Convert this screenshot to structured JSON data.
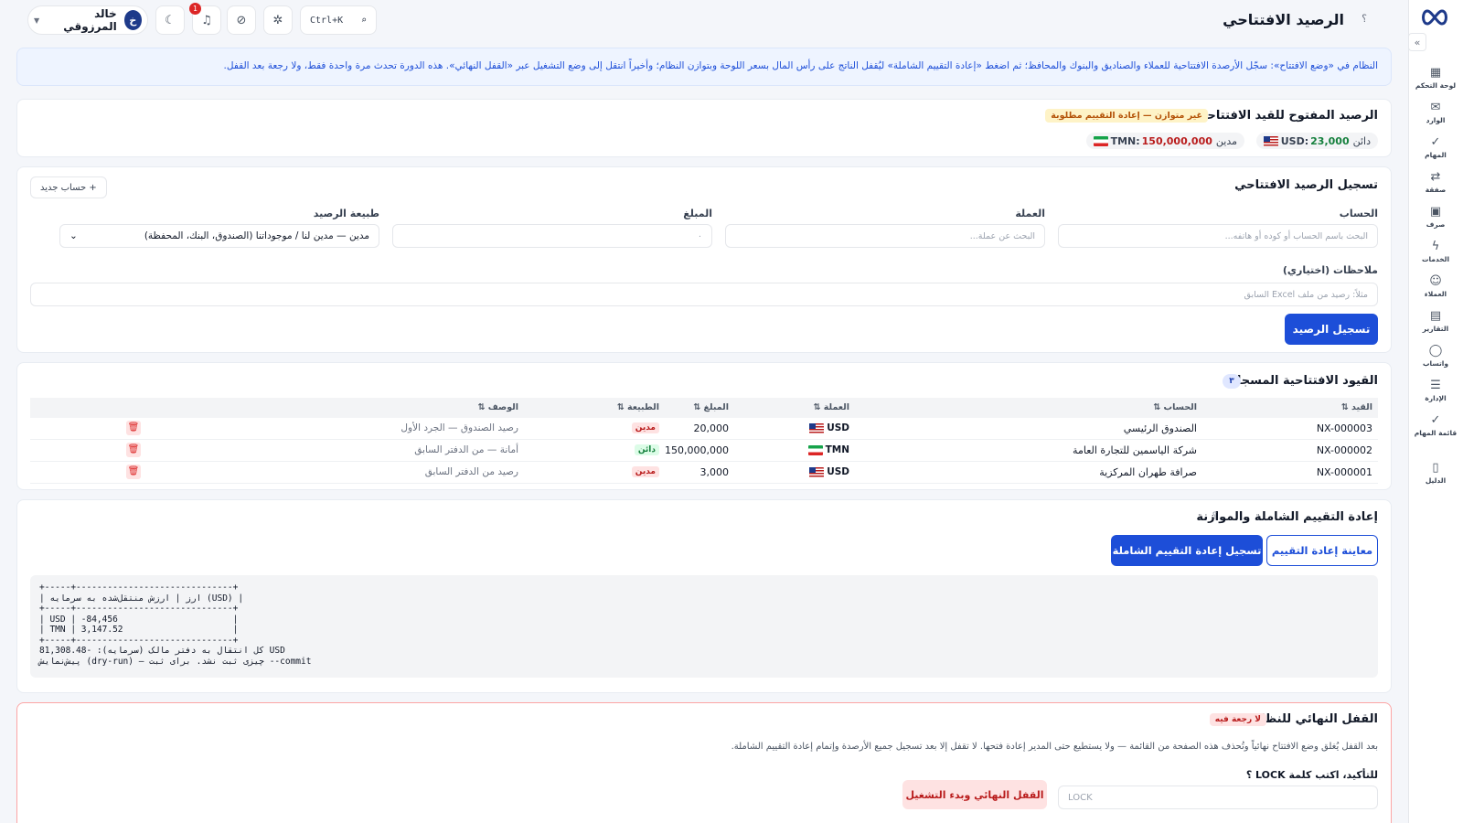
{
  "topbar": {
    "title": "الرصيد الافتتاحي",
    "help": "؟",
    "search_shortcut": "Ctrl+K",
    "notifications_count": "1",
    "user": {
      "initial": "خ",
      "name": "خالد المرزوقي"
    }
  },
  "sidebar": {
    "collapse": "»",
    "items": [
      {
        "label": "لوحة التحكم",
        "icon": "dashboard-icon",
        "glyph": "▦"
      },
      {
        "label": "الوارد",
        "icon": "inbox-icon",
        "glyph": "✉"
      },
      {
        "label": "المهام",
        "icon": "check-icon",
        "glyph": "✓"
      },
      {
        "label": "صفقة",
        "icon": "exchange-icon",
        "glyph": "⇄"
      },
      {
        "label": "صرف",
        "icon": "cash-icon",
        "glyph": "▣"
      },
      {
        "label": "الخدمات",
        "icon": "bolt-icon",
        "glyph": "ϟ"
      },
      {
        "label": "العملاء",
        "icon": "users-icon",
        "glyph": "☺"
      },
      {
        "label": "التقارير",
        "icon": "report-icon",
        "glyph": "▤"
      },
      {
        "label": "واتساب",
        "icon": "chat-icon",
        "glyph": "◯"
      },
      {
        "label": "الإدارة",
        "icon": "sliders-icon",
        "glyph": "☰"
      },
      {
        "label": "قائمة المهام",
        "icon": "tasks-icon",
        "glyph": "✓"
      },
      {
        "label": "الدليل",
        "icon": "book-icon",
        "glyph": "▯"
      }
    ]
  },
  "banner": {
    "text": "النظام في «وضع الافتتاح»: سجّل الأرصدة الافتتاحية للعملاء والصناديق والبنوك والمحافظ؛ ثم اضغط «إعادة التقييم الشاملة» ليُقفل الناتج على رأس المال بسعر اللوحة وبتوازن النظام؛ وأخيراً انتقل إلى وضع التشغيل عبر «القفل النهائي». هذه الدورة تحدث مرة واحدة فقط، ولا رجعة بعد القفل."
  },
  "open_balance": {
    "title": "الرصيد المفتوح للقيد الافتتاحي",
    "status": "غير متوازن — إعادة التقييم مطلوبة",
    "balances": [
      {
        "ccy": "USD",
        "amount": "23,000",
        "side": "دائن"
      },
      {
        "ccy": "TMN",
        "amount": "150,000,000",
        "side": "مدين"
      }
    ]
  },
  "form": {
    "title": "تسجيل الرصيد الافتتاحي",
    "new_account": "+ حساب جديد",
    "account_label": "الحساب",
    "account_placeholder": "البحث باسم الحساب أو كوده أو هاتفه...",
    "currency_label": "العملة",
    "currency_placeholder": "البحث عن عملة...",
    "amount_label": "المبلغ",
    "amount_placeholder": "٠",
    "nature_label": "طبيعة الرصيد",
    "nature_value": "مدين — مدين لنا / موجوداتنا (الصندوق، البنك، المحفظة)",
    "notes_label": "ملاحظات (اختياري)",
    "notes_placeholder": "مثلاً: رصيد من ملف Excel السابق",
    "submit": "تسجيل الرصيد"
  },
  "entries": {
    "title": "القيود الافتتاحية المسجلة",
    "count": "٣",
    "columns": [
      "القيد ⇅",
      "الحساب ⇅",
      "العملة ⇅",
      "المبلغ ⇅",
      "الطبيعة ⇅",
      "الوصف ⇅"
    ],
    "rows": [
      {
        "id": "NX-000003",
        "account": "الصندوق الرئيسي",
        "ccy": "USD",
        "flag": "us",
        "amount": "20,000",
        "nature": "مدين",
        "nature_type": "debit",
        "desc": "رصيد الصندوق — الجرد الأول"
      },
      {
        "id": "NX-000002",
        "account": "شركة الياسمين للتجارة العامة",
        "ccy": "TMN",
        "flag": "ir",
        "amount": "150,000,000",
        "nature": "دائن",
        "nature_type": "credit",
        "desc": "أمانة — من الدفتر السابق"
      },
      {
        "id": "NX-000001",
        "account": "صرافة طهران المركزية",
        "ccy": "USD",
        "flag": "us",
        "amount": "3,000",
        "nature": "مدين",
        "nature_type": "debit",
        "desc": "رصيد من الدفتر السابق"
      }
    ],
    "delete_glyph": "🗑"
  },
  "reval": {
    "title": "إعادة التقييم الشاملة والموازنة",
    "help": "؟",
    "preview_btn": "معاينة إعادة التقييم",
    "commit_btn": "تسجيل إعادة التقييم الشاملة",
    "console": "+-----+------------------------------+\n| ارز | ارزش منتقل‌شده به سرمایه (USD) |\n+-----+------------------------------+\n| USD | -84,456                      |\n| TMN | 3,147.52                     |\n+-----+------------------------------+\nکل انتقال به دفتر مالک (سرمایه): -81,308.48 USD\nپیش‌نمایش (dry-run) — چیزی ثبت نشد. برای ثبت --commit"
  },
  "lock": {
    "title": "القفل النهائي للنظام",
    "badge": "لا رجعة فيه",
    "description": "بعد القفل يُغلق وضع الافتتاح نهائياً وتُحذف هذه الصفحة من القائمة — ولا يستطيع حتى المدير إعادة فتحها. لا تقفل إلا بعد تسجيل جميع الأرصدة وإتمام إعادة التقييم الشاملة.",
    "confirm_label": "للتأكيد، اكتب كلمة LOCK ؟",
    "input_placeholder": "LOCK",
    "button": "القفل النهائي وبدء التشغيل"
  },
  "colors": {
    "primary": "#1d4ed8",
    "danger": "#b91c1c",
    "success": "#15803d",
    "warning": "#b45309"
  }
}
